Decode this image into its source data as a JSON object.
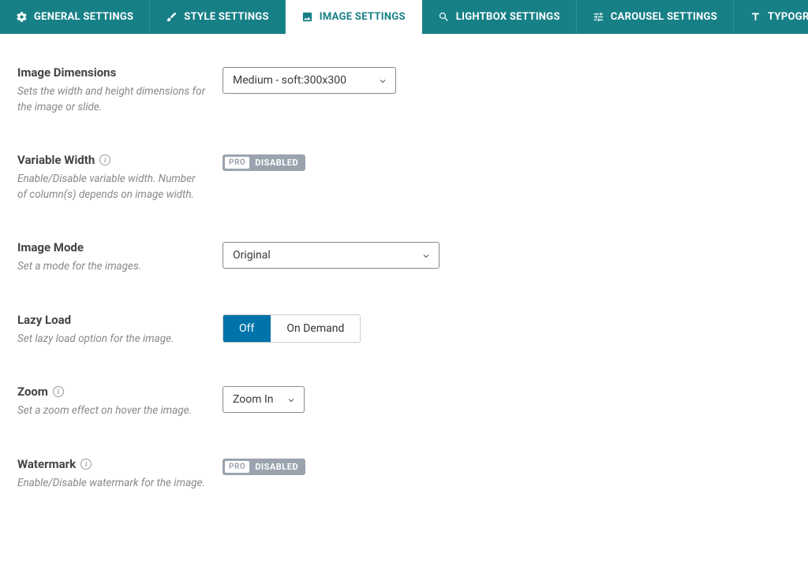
{
  "tabs": [
    {
      "label": "GENERAL SETTINGS"
    },
    {
      "label": "STYLE SETTINGS"
    },
    {
      "label": "IMAGE SETTINGS"
    },
    {
      "label": "LIGHTBOX SETTINGS"
    },
    {
      "label": "CAROUSEL SETTINGS"
    },
    {
      "label": "TYPOGRAPHY"
    }
  ],
  "pro": {
    "disabled": "DISABLED",
    "pro": "PRO"
  },
  "f": {
    "dims": {
      "title": "Image Dimensions",
      "desc": "Sets the width and height dimensions for the image or slide.",
      "value": "Medium - soft:300x300"
    },
    "varw": {
      "title": "Variable Width",
      "desc": "Enable/Disable variable width. Number of column(s) depends on image width."
    },
    "mode": {
      "title": "Image Mode",
      "desc": "Set a mode for the images.",
      "value": "Original"
    },
    "lazy": {
      "title": "Lazy Load",
      "desc": "Set lazy load option for the image.",
      "opt0": "Off",
      "opt1": "On Demand"
    },
    "zoom": {
      "title": "Zoom",
      "desc": "Set a zoom effect on hover the image.",
      "value": "Zoom In"
    },
    "wmark": {
      "title": "Watermark",
      "desc": "Enable/Disable watermark for the image."
    }
  }
}
